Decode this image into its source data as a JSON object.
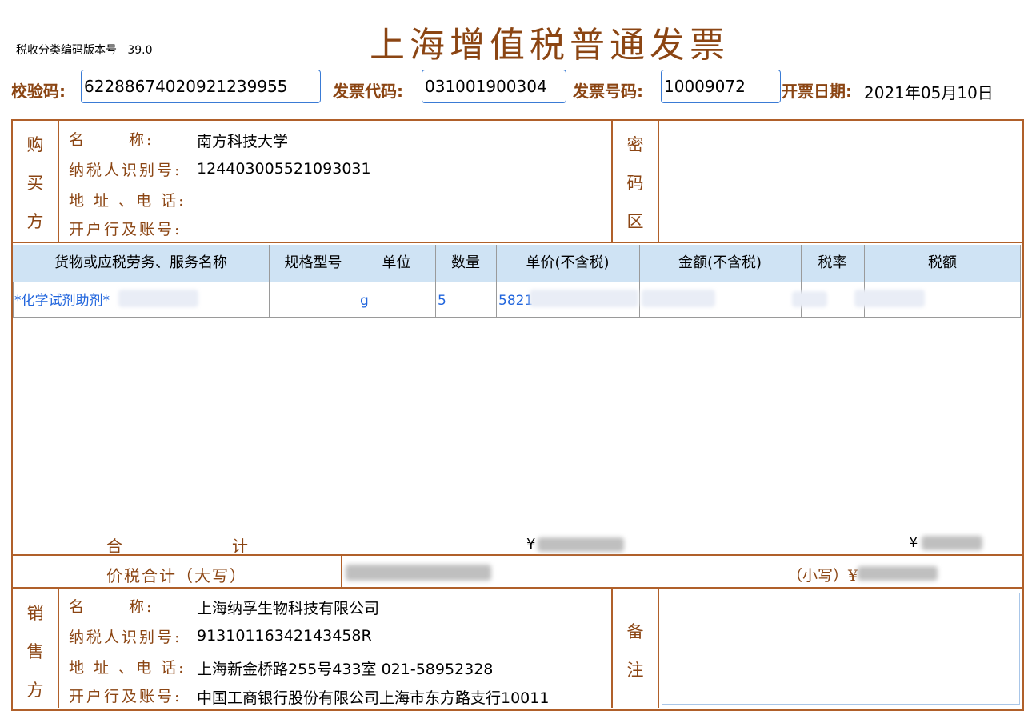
{
  "header": {
    "title": "上海增值税普通发票",
    "version_label": "税收分类编码版本号",
    "version_value": "39.0",
    "check_code_label": "校验码:",
    "check_code": "62288674020921239955",
    "invoice_code_label": "发票代码:",
    "invoice_code": "031001900304",
    "invoice_number_label": "发票号码:",
    "invoice_number": "10009072",
    "date_label": "开票日期:",
    "date": "2021年05月10日"
  },
  "buyer": {
    "section_label": [
      "购",
      "买",
      "方"
    ],
    "name_label": "名　　 称:",
    "name": "南方科技大学",
    "tax_id_label": "纳税人识别号:",
    "tax_id": "124403005521093031",
    "address_label": "地 址 、电 话:",
    "address": "",
    "bank_label": "开户行及账号:",
    "bank": ""
  },
  "cipher": {
    "section_label": [
      "密",
      "码",
      "区"
    ]
  },
  "items": {
    "headers": [
      "货物或应税劳务、服务名称",
      "规格型号",
      "单位",
      "数量",
      "单价(不含税)",
      "金额(不含税)",
      "税率",
      "税额"
    ],
    "rows": [
      {
        "name": "*化学试剂助剂*",
        "spec": "",
        "unit": "g",
        "qty": "5",
        "price": "5821",
        "amount": "",
        "rate": "",
        "tax": ""
      }
    ]
  },
  "totals": {
    "sum_label_1": "合",
    "sum_label_2": "计",
    "amount": "¥",
    "tax": "¥",
    "total_caps_label": "价税合计（大写）",
    "total_caps_value": "",
    "total_small_label": "（小写）¥",
    "total_small_value": ""
  },
  "seller": {
    "section_label": [
      "销",
      "售",
      "方"
    ],
    "name_label": "名　　 称:",
    "name": "上海纳孚生物科技有限公司",
    "tax_id_label": "纳税人识别号:",
    "tax_id": "91310116342143458R",
    "address_label": "地 址 、电 话:",
    "address": "上海新金桥路255号433室 021-58952328",
    "bank_label": "开户行及账号:",
    "bank": "中国工商银行股份有限公司上海市东方路支行10011"
  },
  "remarks": {
    "section_label": [
      "备",
      "注"
    ]
  },
  "colors": {
    "label_brown": "#8b4513",
    "frame": "#b0602a",
    "input_border": "#3a7bd5",
    "table_header_bg": "#cfe3f4",
    "item_text": "#2266dd"
  }
}
